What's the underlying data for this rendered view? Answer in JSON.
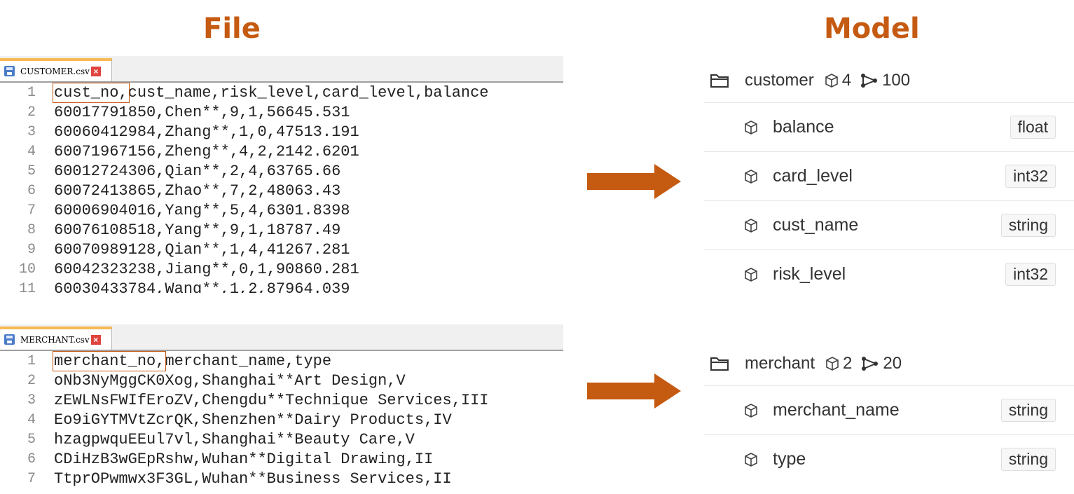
{
  "headings": {
    "file": "File",
    "model": "Model"
  },
  "colors": {
    "accent": "#c55a11",
    "tab_top": "#f7b955"
  },
  "editors": [
    {
      "tab": "CUSTOMER.csv",
      "highlight": "cust_no,",
      "lines": [
        {
          "n": "1",
          "rest": "cust_name,risk_level,card_level,balance"
        },
        {
          "n": "2",
          "text": "60017791850,Chen**,9,1,56645.531"
        },
        {
          "n": "3",
          "text": "60060412984,Zhang**,1,0,47513.191"
        },
        {
          "n": "4",
          "text": "60071967156,Zheng**,4,2,2142.6201"
        },
        {
          "n": "5",
          "text": "60012724306,Qian**,2,4,63765.66"
        },
        {
          "n": "6",
          "text": "60072413865,Zhao**,7,2,48063.43"
        },
        {
          "n": "7",
          "text": "60006904016,Yang**,5,4,6301.8398"
        },
        {
          "n": "8",
          "text": "60076108518,Yang**,9,1,18787.49"
        },
        {
          "n": "9",
          "text": "60070989128,Qian**,1,4,41267.281"
        },
        {
          "n": "10",
          "text": "60042323238,Jiang**,0,1,90860.281"
        },
        {
          "n": "11",
          "text": "60030433784,Wang**,1,2,87964.039"
        }
      ]
    },
    {
      "tab": "MERCHANT.csv",
      "highlight": "merchant_no,",
      "lines": [
        {
          "n": "1",
          "rest": "merchant_name,type"
        },
        {
          "n": "2",
          "text": "oNb3NyMggCK0Xog,Shanghai**Art Design,V"
        },
        {
          "n": "3",
          "text": "zEWLNsFWIfEroZV,Chengdu**Technique Services,III"
        },
        {
          "n": "4",
          "text": "Eo9iGYTMVtZcrQK,Shenzhen**Dairy Products,IV"
        },
        {
          "n": "5",
          "text": "hzagpwquEEul7vl,Shanghai**Beauty Care,V"
        },
        {
          "n": "6",
          "text": "CDiHzB3wGEpRshw,Wuhan**Digital Drawing,II"
        },
        {
          "n": "7",
          "text": "TtprOPwmwx3F3GL,Wuhan**Business Services,II"
        }
      ]
    }
  ],
  "models": [
    {
      "name": "customer",
      "props": "4",
      "edges": "100",
      "fields": [
        {
          "name": "balance",
          "type": "float"
        },
        {
          "name": "card_level",
          "type": "int32"
        },
        {
          "name": "cust_name",
          "type": "string"
        },
        {
          "name": "risk_level",
          "type": "int32"
        }
      ]
    },
    {
      "name": "merchant",
      "props": "2",
      "edges": "20",
      "fields": [
        {
          "name": "merchant_name",
          "type": "string"
        },
        {
          "name": "type",
          "type": "string"
        }
      ]
    }
  ]
}
